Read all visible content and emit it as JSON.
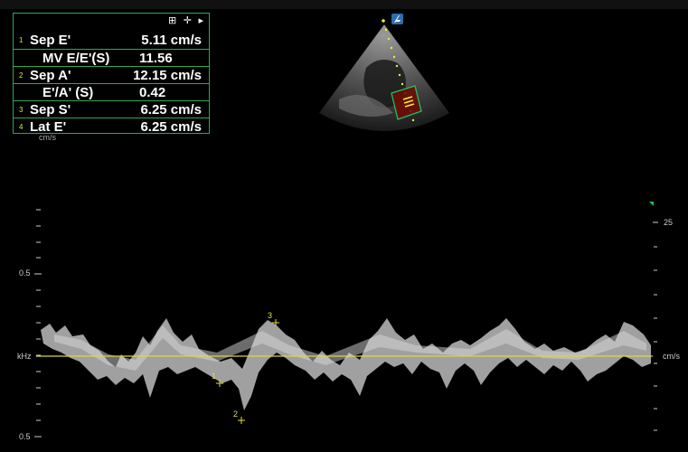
{
  "measurements": {
    "rows": [
      {
        "num": "1",
        "label": "Sep E'",
        "value": "5.11 cm/s"
      },
      {
        "num": "",
        "label": "MV E/E'(S)",
        "value": "11.56"
      },
      {
        "num": "2",
        "label": "Sep A'",
        "value": "12.15 cm/s"
      },
      {
        "num": "",
        "label": "E'/A' (S)",
        "value": "0.42"
      },
      {
        "num": "3",
        "label": "Sep S'",
        "value": "6.25 cm/s"
      },
      {
        "num": "4",
        "label": "Lat E'",
        "value": "6.25 cm/s"
      }
    ],
    "header_icons": "⊞ ✛ ▸"
  },
  "left_axis": {
    "unit_top": "cm/s",
    "tick_top": "0.5",
    "baseline_unit": "kHz",
    "tick_bottom": "0.5"
  },
  "right_axis": {
    "tick_top": "25",
    "baseline_unit": "cm/s"
  },
  "cursor_labels": [
    "1",
    "2",
    "3"
  ],
  "colors": {
    "frame": "#2fa84f",
    "baseline": "#d8d64a",
    "cursor": "#e6e23a",
    "doppler_box": "#20c060",
    "color_flow": "#8b1a0a"
  }
}
